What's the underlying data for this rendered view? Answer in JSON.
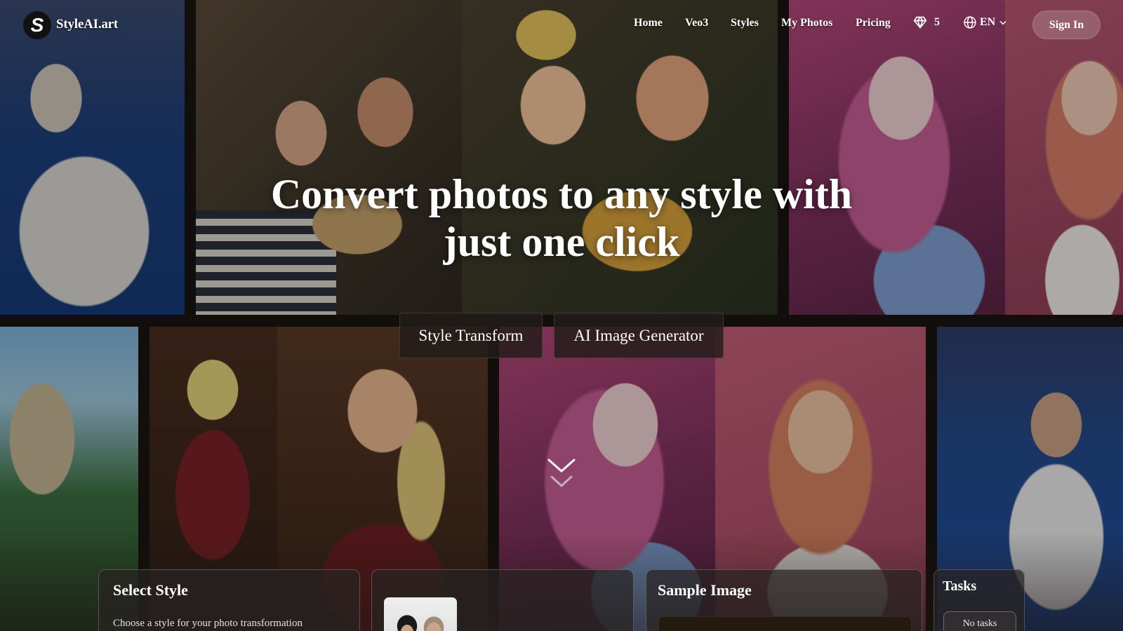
{
  "header": {
    "logo_letter": "S",
    "brand": "StyleAI.art",
    "nav": [
      {
        "label": "Home"
      },
      {
        "label": "Veo3"
      },
      {
        "label": "Styles"
      },
      {
        "label": "My Photos"
      },
      {
        "label": "Pricing"
      }
    ],
    "credits": {
      "icon": "diamond-icon",
      "value": "5"
    },
    "language": {
      "icon": "globe-icon",
      "value": "EN"
    },
    "sign_in": "Sign In"
  },
  "hero": {
    "title_line1": "Convert photos to any style with",
    "title_line2": "just one click",
    "tabs": [
      {
        "label": "Style Transform"
      },
      {
        "label": "AI Image Generator"
      }
    ]
  },
  "cards": {
    "select_style": {
      "title": "Select Style",
      "subtitle": "Choose a style for your photo transformation"
    },
    "sample_image": {
      "title": "Sample Image"
    },
    "tasks": {
      "title": "Tasks",
      "empty": "No tasks"
    }
  }
}
